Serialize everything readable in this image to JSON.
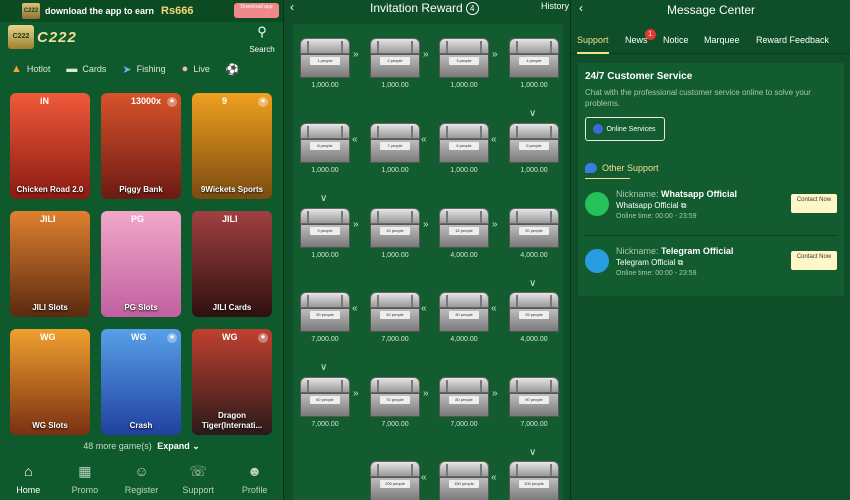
{
  "left": {
    "download_bar": {
      "logo": "C222",
      "text": "download the app to earn",
      "amount": "Rs666",
      "button": "Download app"
    },
    "brand": {
      "icon": "C222",
      "word": "C222"
    },
    "search_label": "Search",
    "categories": [
      {
        "icon": "flame-icon",
        "label": "Hotlot"
      },
      {
        "icon": "cards-icon",
        "label": "Cards"
      },
      {
        "icon": "fish-icon",
        "label": "Fishing"
      },
      {
        "icon": "person-icon",
        "label": "Live"
      },
      {
        "icon": "ball-icon",
        "label": ""
      }
    ],
    "games": [
      {
        "name": "Chicken Road 2.0",
        "badge": "iN",
        "color1": "#f05a3a",
        "color2": "#8a1a12"
      },
      {
        "name": "Piggy Bank",
        "badge": "13000x",
        "color1": "#d8532a",
        "color2": "#6c1a14"
      },
      {
        "name": "9Wickets Sports",
        "badge": "9",
        "color1": "#f0a020",
        "color2": "#7a4a10"
      },
      {
        "name": "JILI Slots",
        "badge": "JILI",
        "color1": "#e08030",
        "color2": "#5a2a10"
      },
      {
        "name": "PG Slots",
        "badge": "PG",
        "color1": "#f2a8c8",
        "color2": "#c060a0"
      },
      {
        "name": "JILI Cards",
        "badge": "JILI",
        "color1": "#a04040",
        "color2": "#301010"
      },
      {
        "name": "WG Slots",
        "badge": "WG",
        "color1": "#f0a030",
        "color2": "#7a3010"
      },
      {
        "name": "Crash",
        "badge": "WG",
        "color1": "#58a0e8",
        "color2": "#2040a0"
      },
      {
        "name": "Dragon Tiger(Internati...",
        "badge": "WG",
        "color1": "#c04030",
        "color2": "#2a1a1a"
      }
    ],
    "more_text": "48 more game(s)",
    "expand_label": "Expand",
    "nav": [
      {
        "icon": "home-icon",
        "label": "Home"
      },
      {
        "icon": "gift-icon",
        "label": "Promo"
      },
      {
        "icon": "add-user-icon",
        "label": "Register"
      },
      {
        "icon": "headset-icon",
        "label": "Support"
      },
      {
        "icon": "profile-icon",
        "label": "Profile"
      }
    ]
  },
  "middle": {
    "title": "Invitation Reward",
    "count": "4",
    "history": "History",
    "rewards": [
      {
        "people": "1 people",
        "value": "1,000.00"
      },
      {
        "people": "2 people",
        "value": "1,000.00"
      },
      {
        "people": "3 people",
        "value": "1,000.00"
      },
      {
        "people": "4 people",
        "value": "1,000.00"
      },
      {
        "people": "5 people",
        "value": "1,000.00"
      },
      {
        "people": "6 people",
        "value": "1,000.00"
      },
      {
        "people": "7 people",
        "value": "1,000.00"
      },
      {
        "people": "8 people",
        "value": "1,000.00"
      },
      {
        "people": "9 people",
        "value": "1,000.00"
      },
      {
        "people": "10 people",
        "value": "1,000.00"
      },
      {
        "people": "15 people",
        "value": "4,000.00"
      },
      {
        "people": "20 people",
        "value": "4,000.00"
      },
      {
        "people": "25 people",
        "value": "4,000.00"
      },
      {
        "people": "30 people",
        "value": "4,000.00"
      },
      {
        "people": "40 people",
        "value": "7,000.00"
      },
      {
        "people": "50 people",
        "value": "7,000.00"
      },
      {
        "people": "60 people",
        "value": "7,000.00"
      },
      {
        "people": "70 people",
        "value": "7,000.00"
      },
      {
        "people": "80 people",
        "value": "7,000.00"
      },
      {
        "people": "90 people",
        "value": "7,000.00"
      },
      {
        "people": "100 people",
        "value": ""
      },
      {
        "people": "150 people",
        "value": ""
      },
      {
        "people": "200 people",
        "value": ""
      }
    ]
  },
  "right": {
    "title": "Message Center",
    "tabs": [
      {
        "label": "Support",
        "active": true
      },
      {
        "label": "News",
        "badge": "1"
      },
      {
        "label": "Notice"
      },
      {
        "label": "Marquee"
      },
      {
        "label": "Reward Feedback"
      }
    ],
    "cs_title": "24/7 Customer Service",
    "cs_desc": "Chat with the professional customer service online to solve your problems.",
    "online_button": "Online Services",
    "other_support": "Other Support",
    "contacts": [
      {
        "nick_label": "Nickname:",
        "nick": "Whatsapp Official",
        "sub": "Whatsapp Official",
        "time": "Online time: 00:00 - 23:59",
        "button": "Contact Now",
        "color": "#25c15a"
      },
      {
        "nick_label": "Nickname:",
        "nick": "Telegram Official",
        "sub": "Telegram Official",
        "time": "Online time: 00:00 - 23:59",
        "button": "Contact Now",
        "color": "#2a9de0"
      }
    ]
  }
}
